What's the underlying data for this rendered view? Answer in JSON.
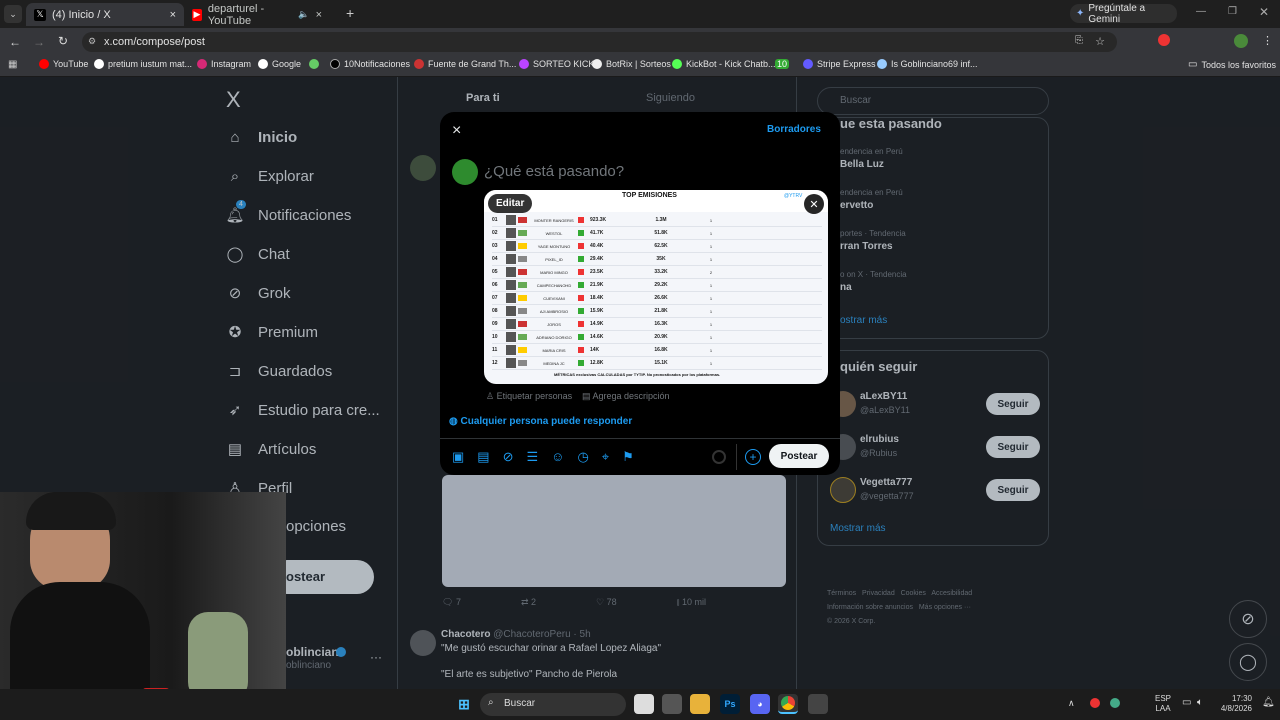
{
  "browser": {
    "tabs": [
      {
        "label": "(4) Inicio / X",
        "close": "×"
      },
      {
        "label": "departurel - YouTube",
        "close": "×"
      }
    ],
    "new_tab": "+",
    "gemini": "Pregúntale a Gemini",
    "url": "x.com/compose/post"
  },
  "bookmarks": [
    "YouTube",
    "pretium iustum mat...",
    "Instagram",
    "Google",
    "10Notificaciones",
    "Fuente de Grand Th...",
    "SORTEO KICK",
    "BotRix | Sorteos",
    "KickBot - Kick Chatb...",
    "10",
    "Stripe Express",
    "Is Goblinciano69 inf..."
  ],
  "bookmarks_all": "Todos los favoritos",
  "nav": {
    "logo": "X",
    "items": [
      "Inicio",
      "Explorar",
      "Notificaciones",
      "Chat",
      "Grok",
      "Premium",
      "Guardados",
      "Estudio para cre...",
      "Artículos",
      "Perfil",
      "opciones"
    ],
    "notif_badge": "4",
    "post_button": "ostear",
    "account_name": "oblinciano",
    "account_handle": "oblinciano",
    "more": "···"
  },
  "feed": {
    "tab_for_you": "Para ti",
    "tab_following": "Siguiendo",
    "stats": {
      "replies": "7",
      "reposts": "2",
      "likes": "78",
      "views": "10 mil"
    },
    "tweet": {
      "name": "Chacotero",
      "handle": "@ChacoteroPeru · 5h",
      "line1": "\"Me gustó escuchar orinar a Rafael Lopez Aliaga\"",
      "line2": "\"El arte es subjetivo\" Pancho de Pierola"
    }
  },
  "right": {
    "search_placeholder": "Buscar",
    "trends_title": "ue esta pasando",
    "trends": [
      {
        "meta": "endencia en Perú",
        "name": "Bella Luz"
      },
      {
        "meta": "endencia en Perú",
        "name": "ervetto"
      },
      {
        "meta": "portes · Tendencia",
        "name": "rran Torres"
      },
      {
        "meta": "o on X · Tendencia",
        "name": "na"
      }
    ],
    "show_more": "ostrar más",
    "who_title": "quién seguir",
    "who": [
      {
        "name": "aLexBY11",
        "handle": "@aLexBY11"
      },
      {
        "name": "elrubius",
        "handle": "@Rubius"
      },
      {
        "name": "Vegetta777",
        "handle": "@vegetta777"
      }
    ],
    "follow": "Seguir",
    "show_more2": "Mostrar más",
    "footer": [
      "Términos",
      "Privacidad",
      "Cookies",
      "Accesibilidad",
      "Información sobre anuncios",
      "Más opciones ···",
      "© 2026 X Corp."
    ]
  },
  "compose": {
    "close": "×",
    "drafts": "Borradores",
    "placeholder": "¿Qué está pasando?",
    "edit": "Editar",
    "tag_people": "Etiquetar personas",
    "add_description": "Agrega descripción",
    "reply_setting": "Cualquier persona puede responder",
    "post_button": "Postear",
    "add": "+"
  },
  "image": {
    "title": "TOP EMISIONES",
    "subtitle": "@YTRV",
    "footer": "MÉTRICAS exclusivas CALCULADAS por TYTIP. No pronosticados por los plataformas.",
    "rows": [
      [
        "01",
        "MONTER RANGERIS",
        "923.3K",
        "1.3M",
        "1"
      ],
      [
        "02",
        "WESTOL",
        "41.7K",
        "51.8K",
        "1"
      ],
      [
        "03",
        "YAGE MONTUNO",
        "40.4K",
        "62.5K",
        "1"
      ],
      [
        "04",
        "PIXEL_ID",
        "29.4K",
        "35K",
        "1"
      ],
      [
        "05",
        "MARIO MINGO",
        "23.5K",
        "33.2K",
        "2"
      ],
      [
        "06",
        "CAMPECHANOHD",
        "21.9K",
        "29.2K",
        "1"
      ],
      [
        "07",
        "CUEVIXANI",
        "18.4K",
        "26.6K",
        "1"
      ],
      [
        "08",
        "AJI AMBROSIO",
        "15.9K",
        "21.8K",
        "1"
      ],
      [
        "09",
        "JOROS",
        "14.9K",
        "16.3K",
        "1"
      ],
      [
        "10",
        "ADRIANO DORIGO",
        "14.6K",
        "20.9K",
        "1"
      ],
      [
        "11",
        "MARIA CRIS",
        "14K",
        "16.8K",
        "1"
      ],
      [
        "12",
        "MEDINA JC",
        "12.8K",
        "15.1K",
        "1"
      ]
    ]
  },
  "taskbar": {
    "search": "Buscar",
    "lang1": "ESP",
    "lang2": "LAA",
    "time": "17:30",
    "date": "4/8/2026"
  },
  "colors": {
    "accent": "#1d9bf0",
    "bg": "#000000"
  }
}
